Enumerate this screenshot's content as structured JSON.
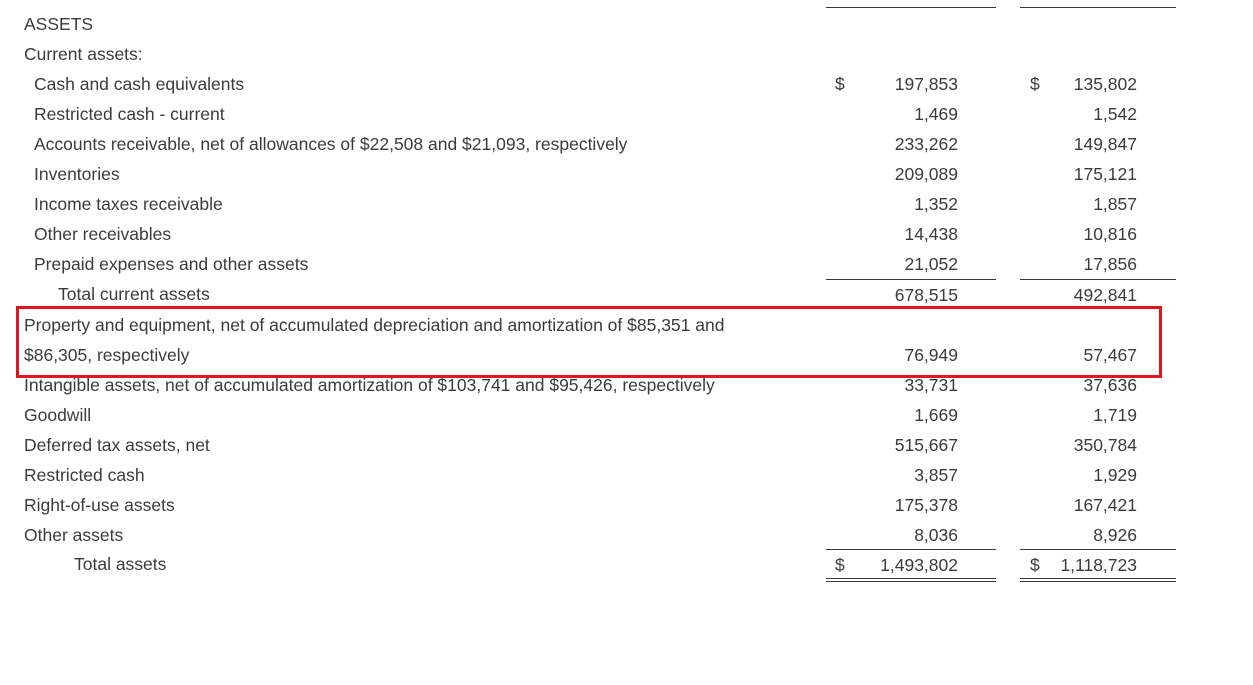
{
  "section_title": "ASSETS",
  "subsection_title": "Current assets:",
  "rows": [
    {
      "label": "Cash and cash equivalents",
      "dollar": "$",
      "v1": "197,853",
      "v2": "135,802"
    },
    {
      "label": "Restricted cash - current",
      "v1": "1,469",
      "v2": "1,542"
    },
    {
      "label": "Accounts receivable, net of allowances of $22,508 and $21,093, respectively",
      "v1": "233,262",
      "v2": "149,847"
    },
    {
      "label": "Inventories",
      "v1": "209,089",
      "v2": "175,121"
    },
    {
      "label": "Income taxes receivable",
      "v1": "1,352",
      "v2": "1,857"
    },
    {
      "label": "Other receivables",
      "v1": "14,438",
      "v2": "10,816"
    },
    {
      "label": "Prepaid expenses and other assets",
      "v1": "21,052",
      "v2": "17,856"
    },
    {
      "label": "Total current assets",
      "v1": "678,515",
      "v2": "492,841"
    },
    {
      "label": "Property and equipment, net of accumulated depreciation and amortization of $85,351 and",
      "v1": "",
      "v2": ""
    },
    {
      "label": "$86,305, respectively",
      "v1": "76,949",
      "v2": "57,467"
    },
    {
      "label": "Intangible assets, net of accumulated amortization of $103,741 and $95,426, respectively",
      "v1": "33,731",
      "v2": "37,636"
    },
    {
      "label": "Goodwill",
      "v1": "1,669",
      "v2": "1,719"
    },
    {
      "label": "Deferred tax assets, net",
      "v1": "515,667",
      "v2": "350,784"
    },
    {
      "label": "Restricted cash",
      "v1": "3,857",
      "v2": "1,929"
    },
    {
      "label": "Right-of-use assets",
      "v1": "175,378",
      "v2": "167,421"
    },
    {
      "label": "Other assets",
      "v1": "8,036",
      "v2": "8,926"
    },
    {
      "label": "Total assets",
      "dollar": "$",
      "v1": "1,493,802",
      "v2": "1,118,723"
    }
  ],
  "highlight_color": "#e0161e"
}
